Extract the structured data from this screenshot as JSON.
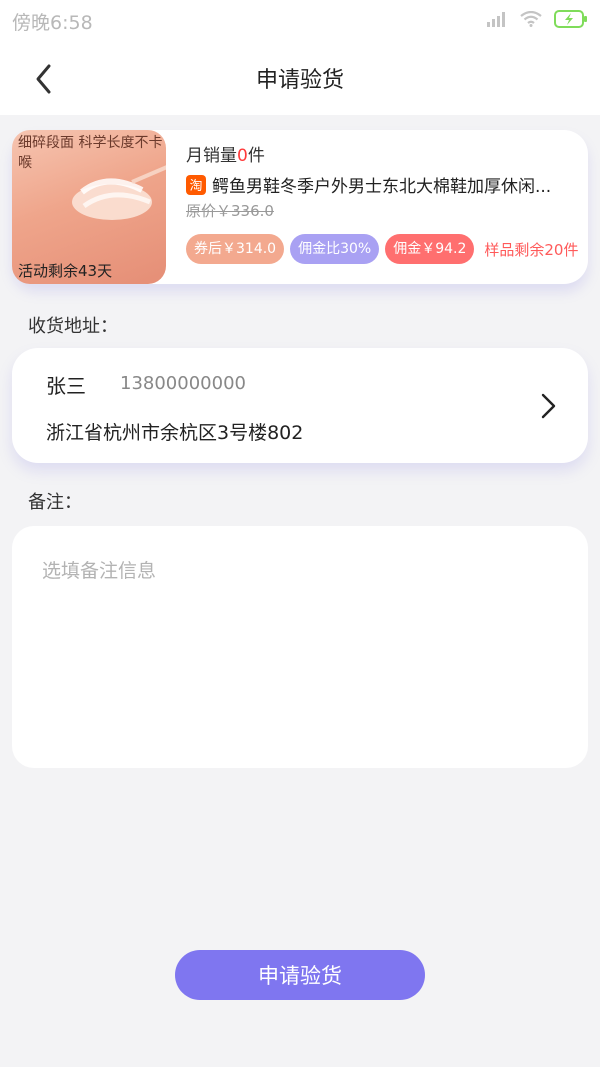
{
  "status_bar": {
    "time": "傍晚6:58",
    "icons": [
      "signal-icon",
      "wifi-icon",
      "battery-charging-icon"
    ],
    "accent": "#7fdc5a"
  },
  "nav": {
    "title": "申请验货",
    "back_icon": "back-arrow-icon"
  },
  "product": {
    "image_headline": "细碎段面 科学长度不卡喉",
    "image_overlay": "活动剩余43天",
    "monthly_sales_label": "月销量",
    "monthly_sales_count": "0",
    "monthly_sales_unit": "件",
    "platform_icon": "taobao-icon",
    "platform_glyph": "淘",
    "title": "鳄鱼男鞋冬季户外男士东北大棉鞋加厚休闲...",
    "original_price": "原价￥336.0",
    "tags": {
      "coupon_price": "券后￥314.0",
      "commission_rate": "佣金比30%",
      "commission_amount": "佣金￥94.2"
    },
    "stock_text": "样品剩余20件"
  },
  "address": {
    "section_label": "收货地址：",
    "name": "张三",
    "phone": "13800000000",
    "detail": "浙江省杭州市余杭区3号楼802"
  },
  "notes": {
    "section_label": "备注：",
    "placeholder": "选填备注信息",
    "value": ""
  },
  "submit": {
    "label": "申请验货"
  },
  "colors": {
    "primary": "#7f76f0",
    "coupon_tag": "#f3a98f",
    "rate_tag": "#a9a1f3",
    "commission_tag": "#ff6f6f",
    "highlight_red": "#ff3b3b",
    "taobao_orange": "#ff5a00"
  }
}
